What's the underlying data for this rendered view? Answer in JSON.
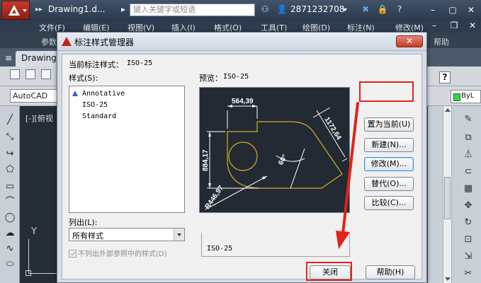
{
  "titlebar": {
    "qat_more": "▸▸",
    "drawing_title": "Drawing1.d...",
    "search_placeholder": "键入关键字或短语",
    "user_id": "2871232708",
    "icons": [
      "binoculars-icon",
      "user-icon",
      "exchange-icon",
      "lock-icon",
      "help-icon"
    ]
  },
  "menu": {
    "items": [
      "文件(F)",
      "编辑(E)",
      "视图(V)",
      "插入(I)",
      "格式(O)",
      "工具(T)",
      "绘图(D)",
      "标注(N)",
      "修改(M)"
    ]
  },
  "ribbon": {
    "item0": "参数",
    "item1": "帮助"
  },
  "filetab": {
    "label": "Drawing"
  },
  "workspace": {
    "label": "AutoCAD"
  },
  "layer": {
    "label": "ByL"
  },
  "viewport": {
    "label": "[-][俯视"
  },
  "ucs": {
    "y": "Y"
  },
  "dialog": {
    "title": "标注样式管理器",
    "close_glyph": "✕",
    "current_style_label": "当前标注样式：",
    "current_style_value": "ISO-25",
    "styles_label": "样式(S):",
    "styles": [
      "Annotative",
      "ISO-25",
      "Standard"
    ],
    "preview_label": "预览：",
    "preview_value": "ISO-25",
    "list_label": "列出(L):",
    "list_value": "所有样式",
    "checkbox_label": "不列出外部参照中的样式(D)",
    "description_label": "说明",
    "description_value": "ISO-25",
    "buttons": {
      "set_current": "置为当前(U)",
      "new": "新建(N)...",
      "modify": "修改(M)...",
      "override": "替代(O)...",
      "compare": "比较(C)...",
      "close": "关闭",
      "help": "帮助(H)"
    },
    "preview_dims": {
      "top": "564,39",
      "left": "884,17",
      "diagonal": "1172,64",
      "angle": "60°",
      "radius": "R446,97"
    }
  },
  "colors": {
    "highlight": "#e2231a",
    "accent_blue": "#3b8fd6",
    "preview_bg": "#232a33",
    "preview_outline": "#d3ac2b"
  }
}
